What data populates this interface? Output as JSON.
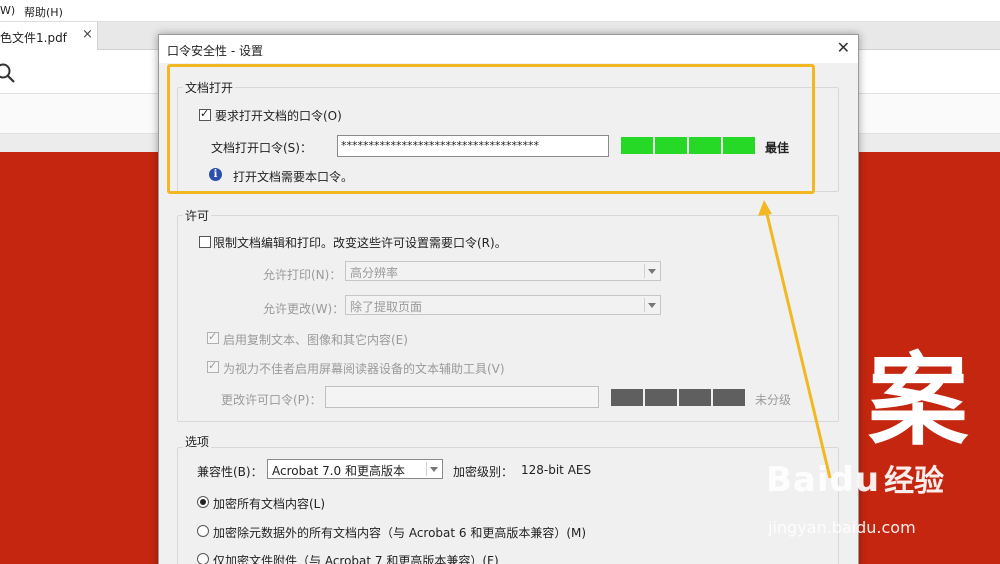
{
  "app": {
    "menu": [
      "W)",
      "帮助(H)"
    ],
    "tab_name": "色文件1.pdf",
    "tab_close": "×"
  },
  "document": {
    "big_text": "案",
    "corner_text": "‘"
  },
  "dialog": {
    "title": "口令安全性 - 设置",
    "close": "✕",
    "doc_open": {
      "group_label": "文档打开",
      "require_checkbox_label": "要求打开文档的口令(O)",
      "require_checked": true,
      "password_label": "文档打开口令(S)：",
      "password_value": "************************************",
      "strength_segments_filled": 4,
      "strength_segments_total": 4,
      "strength_text": "最佳",
      "strength_color": "#27d927",
      "info_text": "打开文档需要本口令。"
    },
    "permissions": {
      "group_label": "许可",
      "restrict_label": "限制文档编辑和打印。改变这些许可设置需要口令(R)。",
      "restrict_checked": false,
      "print_label": "允许打印(N)：",
      "print_value": "高分辨率",
      "change_label": "允许更改(W)：",
      "change_value": "除了提取页面",
      "copy_label": "启用复制文本、图像和其它内容(E)",
      "copy_checked": true,
      "screen_reader_label": "为视力不佳者启用屏幕阅读器设备的文本辅助工具(V)",
      "screen_reader_checked": true,
      "perm_password_label": "更改许可口令(P)：",
      "perm_password_value": "",
      "perm_strength_text": "未分级",
      "perm_strength_color": "#5f5f5f",
      "perm_strength_segments_filled": 0,
      "perm_strength_segments_total": 4
    },
    "options": {
      "group_label": "选项",
      "compat_label": "兼容性(B)：",
      "compat_value": "Acrobat 7.0 和更高版本",
      "encryption_label": "加密级别：",
      "encryption_value": "128-bit AES",
      "radio_all": "加密所有文档内容(L)",
      "radio_all_checked": true,
      "radio_except_meta": "加密除元数据外的所有文档内容（与 Acrobat 6 和更高版本兼容）(M)",
      "radio_attach": "仅加密文件附件（与 Acrobat 7 和更高版本兼容）(F)"
    }
  },
  "annotation": {
    "highlight_color": "#f2b824"
  },
  "watermark": {
    "logo": "Baidu",
    "cn": "经验",
    "url": "jingyan.baidu.com"
  }
}
